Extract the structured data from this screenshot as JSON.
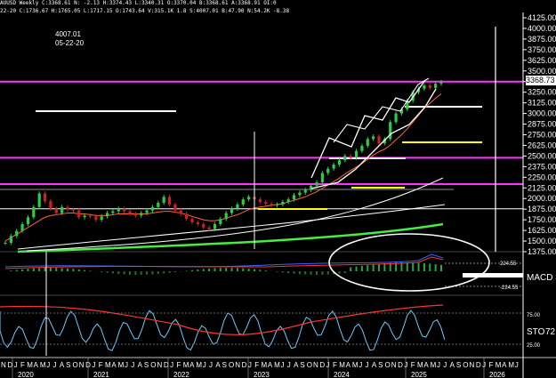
{
  "header": {
    "line1": "AUUSD Weekly C:3368.61 N: -2.13 H:3374.43 L:3340.31 O:3370.04 B:3368.61 A:3368.91 OI:0",
    "line2": "22-20 C:1736.67 H:1765.05 L:1717.15 O:1743.64 V:315.1K 1.8 S:4007.01 B:47.90 N:54.2K -8.38"
  },
  "annotation": {
    "value": "4007.01",
    "date": "05-22-20"
  },
  "price_tag": "3368.73",
  "levels": {
    "macd": "224.55",
    "macd_neg": "-224.55",
    "sto_high": "75.00",
    "sto_low": "25.00"
  },
  "indicators": {
    "macd_label": "MACD 3",
    "sto_label": "STO",
    "sto_value": "72"
  },
  "colors": {
    "price": "#2ecc40",
    "magenta": "#ff33ff",
    "yellow": "#ffff00",
    "white": "#ffffff",
    "orange": "#ff6633",
    "green_ma": "#44ee44",
    "macd_line": "#3366ff",
    "signal": "#ff3333",
    "sto": "#66ccff"
  },
  "chart_data": {
    "type": "line",
    "title": "",
    "y_ticks": [
      "4125.00",
      "4000.00",
      "3875.00",
      "3750.00",
      "3625.00",
      "3500.00",
      "3375.00",
      "3250.00",
      "3125.00",
      "3000.00",
      "2875.00",
      "2750.00",
      "2625.00",
      "2500.00",
      "2375.00",
      "2250.00",
      "2125.00",
      "2000.00",
      "1875.00",
      "1750.00",
      "1625.00",
      "1500.00",
      "1375.00"
    ],
    "ylim": [
      1375,
      4125
    ],
    "months": [
      "N",
      "D",
      "J",
      "F",
      "M",
      "A",
      "M",
      "J",
      "J",
      "A",
      "S",
      "O",
      "N",
      "D",
      "J",
      "F",
      "M",
      "A",
      "M",
      "J",
      "J",
      "A",
      "S",
      "O",
      "N",
      "D",
      "J",
      "F",
      "M",
      "A",
      "M",
      "J",
      "J",
      "A",
      "S",
      "O",
      "N",
      "D",
      "J",
      "F",
      "M",
      "A",
      "M",
      "J",
      "J",
      "A",
      "S",
      "O",
      "N",
      "D",
      "J",
      "F",
      "M",
      "A",
      "M",
      "J",
      "J",
      "A",
      "S",
      "O",
      "N",
      "D",
      "J",
      "F",
      "M",
      "A",
      "M",
      "J",
      "J",
      "A",
      "S",
      "O",
      "N",
      "D",
      "J",
      "F",
      "M",
      "A",
      "M",
      "J"
    ],
    "years": [
      "2020",
      "2021",
      "2022",
      "2023",
      "2024",
      "2025",
      "2026"
    ],
    "horizontal_levels": [
      {
        "name": "magenta-top",
        "value": 3375,
        "color": "magenta"
      },
      {
        "name": "magenta-mid",
        "value": 2480,
        "color": "magenta"
      },
      {
        "name": "magenta-low",
        "value": 2170,
        "color": "magenta"
      },
      {
        "name": "white-level-2",
        "value": 1880,
        "color": "white"
      }
    ],
    "series": [
      {
        "values": [
          1480,
          1560,
          1620,
          1700,
          1780,
          1900,
          2060,
          1970,
          1880,
          1830,
          1900,
          1870,
          1860,
          1780,
          1800,
          1790,
          1750,
          1790,
          1830,
          1850,
          1880,
          1850,
          1820,
          1800,
          1830,
          1860,
          1900,
          1950,
          2020,
          1930,
          1860,
          1820,
          1760,
          1720,
          1700,
          1660,
          1640,
          1700,
          1760,
          1830,
          1880,
          1930,
          1990,
          2020,
          1990,
          1960,
          1940,
          1920,
          1930,
          1960,
          1990,
          2040,
          2070,
          2100,
          2150,
          2190,
          2300,
          2350,
          2400,
          2450,
          2500,
          2480,
          2560,
          2620,
          2700,
          2730,
          2650,
          2700,
          2900,
          3000,
          3050,
          3150,
          3250,
          3290,
          3330,
          3300,
          3350,
          3369
        ]
      },
      {
        "values": [
          1500,
          1540,
          1580,
          1620,
          1660,
          1700,
          1740,
          1780,
          1800,
          1810,
          1820,
          1830,
          1830,
          1820,
          1820,
          1810,
          1800,
          1800,
          1800,
          1810,
          1820,
          1820,
          1820,
          1820,
          1820,
          1820,
          1830,
          1840,
          1850,
          1850,
          1840,
          1830,
          1810,
          1790,
          1770,
          1750,
          1740,
          1740,
          1750,
          1770,
          1790,
          1810,
          1840,
          1870,
          1890,
          1900,
          1910,
          1920,
          1930,
          1940,
          1960,
          1980,
          2000,
          2020,
          2050,
          2080,
          2120,
          2160,
          2200,
          2240,
          2290,
          2330,
          2370,
          2410,
          2460,
          2510,
          2550,
          2580,
          2630,
          2690,
          2750,
          2820,
          2900,
          2980,
          3060,
          3120,
          3180,
          3230
        ]
      }
    ]
  }
}
